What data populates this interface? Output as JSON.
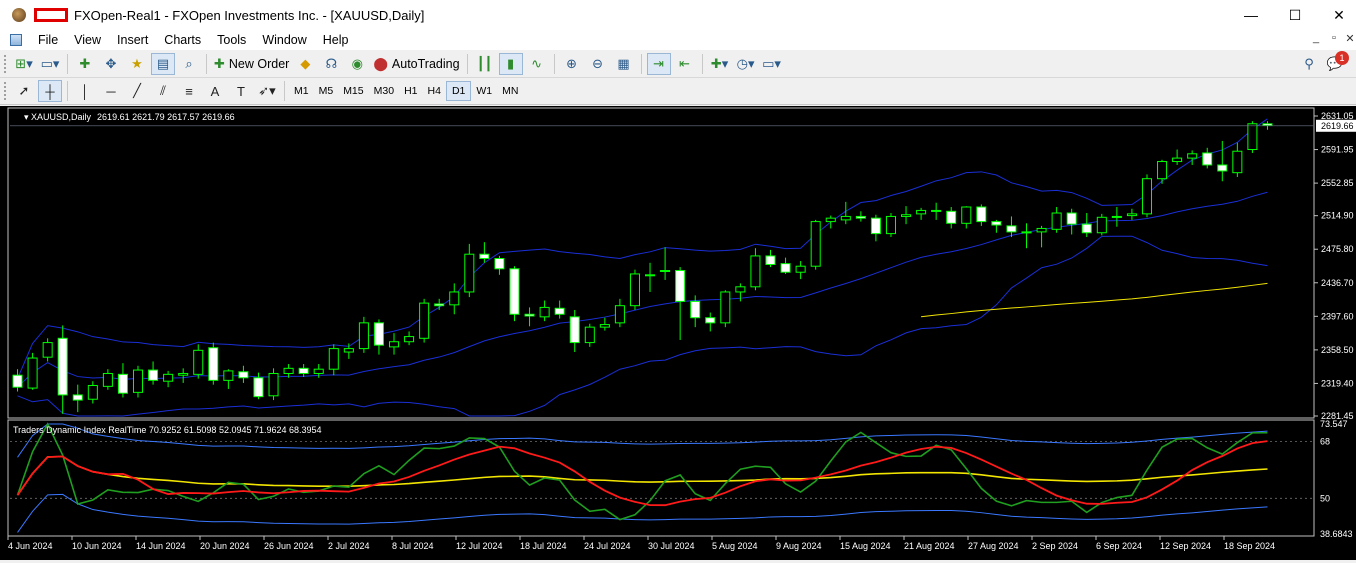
{
  "window": {
    "title": "FXOpen-Real1 - FXOpen Investments Inc. - [XAUUSD,Daily]",
    "controls": {
      "minimize": "—",
      "maximize": "☐",
      "close": "✕"
    }
  },
  "menu": {
    "items": [
      "File",
      "View",
      "Insert",
      "Charts",
      "Tools",
      "Window",
      "Help"
    ],
    "mdi": {
      "minimize": "_",
      "restore": "▫",
      "close": "✕"
    }
  },
  "toolbar": {
    "new_order": "New Order",
    "autotrading": "AutoTrading",
    "notification_count": "1",
    "timeframes": [
      "M1",
      "M5",
      "M15",
      "M30",
      "H1",
      "H4",
      "D1",
      "W1",
      "MN"
    ],
    "active_timeframe": "D1"
  },
  "chart_data": {
    "type": "candlestick",
    "symbol_label": "XAUUSD,Daily",
    "ohlc_label": "2619.61 2621.79 2617.57 2619.66",
    "current_price": "2619.66",
    "price_axis": {
      "labels": [
        "2631.05",
        "2591.95",
        "2552.85",
        "2514.90",
        "2475.80",
        "2436.70",
        "2397.60",
        "2358.50",
        "2319.40",
        "2281.45"
      ],
      "ylim": [
        2281.45,
        2631.05
      ]
    },
    "x_axis": {
      "labels": [
        "4 Jun 2024",
        "10 Jun 2024",
        "14 Jun 2024",
        "20 Jun 2024",
        "26 Jun 2024",
        "2 Jul 2024",
        "8 Jul 2024",
        "12 Jul 2024",
        "18 Jul 2024",
        "24 Jul 2024",
        "30 Jul 2024",
        "5 Aug 2024",
        "9 Aug 2024",
        "15 Aug 2024",
        "21 Aug 2024",
        "27 Aug 2024",
        "2 Sep 2024",
        "6 Sep 2024",
        "12 Sep 2024",
        "18 Sep 2024"
      ]
    },
    "candles": [
      [
        2329,
        2336,
        2310,
        2315
      ],
      [
        2314,
        2355,
        2312,
        2349
      ],
      [
        2350,
        2372,
        2345,
        2367
      ],
      [
        2372,
        2387,
        2284,
        2306
      ],
      [
        2306,
        2318,
        2286,
        2300
      ],
      [
        2301,
        2322,
        2296,
        2317
      ],
      [
        2316,
        2336,
        2312,
        2331
      ],
      [
        2330,
        2343,
        2303,
        2308
      ],
      [
        2309,
        2340,
        2303,
        2335
      ],
      [
        2335,
        2345,
        2318,
        2323
      ],
      [
        2322,
        2334,
        2315,
        2330
      ],
      [
        2329,
        2337,
        2320,
        2331
      ],
      [
        2330,
        2365,
        2325,
        2358
      ],
      [
        2361,
        2367,
        2318,
        2323
      ],
      [
        2323,
        2336,
        2313,
        2334
      ],
      [
        2333,
        2340,
        2320,
        2326
      ],
      [
        2326,
        2332,
        2301,
        2304
      ],
      [
        2305,
        2337,
        2300,
        2331
      ],
      [
        2331,
        2342,
        2326,
        2337
      ],
      [
        2337,
        2342,
        2327,
        2331
      ],
      [
        2331,
        2342,
        2326,
        2336
      ],
      [
        2336,
        2365,
        2329,
        2360
      ],
      [
        2356,
        2366,
        2348,
        2360
      ],
      [
        2360,
        2397,
        2355,
        2390
      ],
      [
        2390,
        2394,
        2353,
        2364
      ],
      [
        2362,
        2378,
        2353,
        2368
      ],
      [
        2368,
        2380,
        2364,
        2374
      ],
      [
        2372,
        2418,
        2367,
        2413
      ],
      [
        2412,
        2418,
        2405,
        2410
      ],
      [
        2411,
        2436,
        2400,
        2426
      ],
      [
        2426,
        2482,
        2420,
        2470
      ],
      [
        2470,
        2484,
        2460,
        2465
      ],
      [
        2465,
        2468,
        2446,
        2453
      ],
      [
        2453,
        2456,
        2392,
        2400
      ],
      [
        2400,
        2408,
        2386,
        2398
      ],
      [
        2397,
        2416,
        2392,
        2408
      ],
      [
        2407,
        2416,
        2395,
        2400
      ],
      [
        2397,
        2405,
        2356,
        2367
      ],
      [
        2367,
        2389,
        2362,
        2385
      ],
      [
        2385,
        2396,
        2381,
        2388
      ],
      [
        2390,
        2418,
        2385,
        2410
      ],
      [
        2410,
        2452,
        2405,
        2447
      ],
      [
        2446,
        2460,
        2426,
        2446
      ],
      [
        2450,
        2478,
        2440,
        2451
      ],
      [
        2451,
        2455,
        2370,
        2415
      ],
      [
        2415,
        2422,
        2385,
        2396
      ],
      [
        2396,
        2402,
        2380,
        2390
      ],
      [
        2390,
        2428,
        2385,
        2426
      ],
      [
        2426,
        2436,
        2415,
        2432
      ],
      [
        2432,
        2477,
        2428,
        2468
      ],
      [
        2468,
        2475,
        2455,
        2458
      ],
      [
        2459,
        2466,
        2447,
        2449
      ],
      [
        2449,
        2462,
        2441,
        2456
      ],
      [
        2456,
        2510,
        2452,
        2508
      ],
      [
        2508,
        2515,
        2500,
        2512
      ],
      [
        2510,
        2531,
        2505,
        2514
      ],
      [
        2514,
        2520,
        2508,
        2512
      ],
      [
        2512,
        2516,
        2485,
        2494
      ],
      [
        2494,
        2518,
        2490,
        2514
      ],
      [
        2514,
        2526,
        2505,
        2516
      ],
      [
        2517,
        2524,
        2510,
        2521
      ],
      [
        2521,
        2530,
        2510,
        2520
      ],
      [
        2520,
        2525,
        2500,
        2506
      ],
      [
        2506,
        2526,
        2500,
        2525
      ],
      [
        2525,
        2528,
        2503,
        2508
      ],
      [
        2508,
        2510,
        2495,
        2504
      ],
      [
        2503,
        2514,
        2490,
        2496
      ],
      [
        2496,
        2506,
        2477,
        2496
      ],
      [
        2496,
        2503,
        2478,
        2500
      ],
      [
        2499,
        2525,
        2495,
        2518
      ],
      [
        2518,
        2523,
        2493,
        2505
      ],
      [
        2505,
        2518,
        2490,
        2495
      ],
      [
        2495,
        2517,
        2492,
        2513
      ],
      [
        2513,
        2525,
        2502,
        2514
      ],
      [
        2515,
        2523,
        2510,
        2517
      ],
      [
        2517,
        2563,
        2513,
        2558
      ],
      [
        2558,
        2580,
        2552,
        2578
      ],
      [
        2578,
        2592,
        2574,
        2582
      ],
      [
        2582,
        2591,
        2574,
        2587
      ],
      [
        2588,
        2594,
        2570,
        2574
      ],
      [
        2574,
        2602,
        2555,
        2567
      ],
      [
        2565,
        2600,
        2560,
        2590
      ],
      [
        2592,
        2625,
        2588,
        2622
      ],
      [
        2622,
        2625,
        2615,
        2620
      ]
    ],
    "bands_note": "Bollinger Bands (blue)",
    "indicator": {
      "label": "Traders Dynamic Index RealTime 70.9252 61.5098 52.0945 71.9624 68.3954",
      "levels": [
        "73.547",
        "68",
        "50",
        "38.6843"
      ]
    }
  }
}
